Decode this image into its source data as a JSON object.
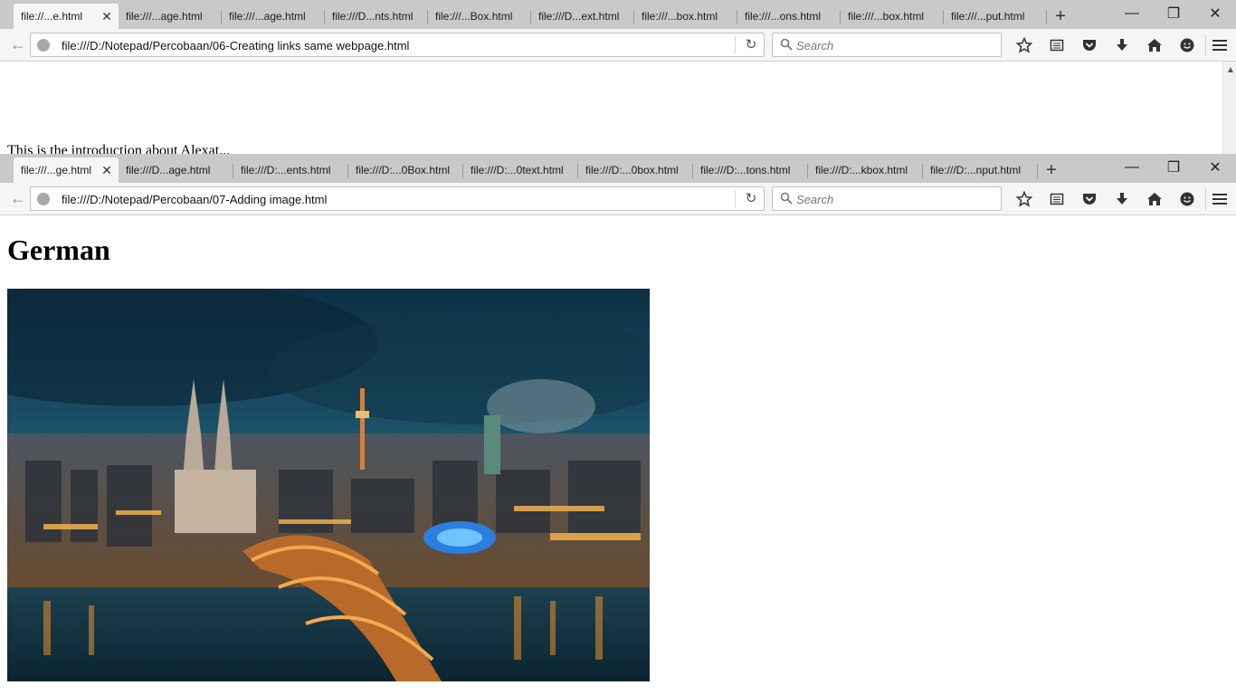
{
  "back_window": {
    "tabs": [
      {
        "label": "file://...e.html",
        "active": true
      },
      {
        "label": "file:///...age.html"
      },
      {
        "label": "file:///...age.html"
      },
      {
        "label": "file:///D...nts.html"
      },
      {
        "label": "file:///...Box.html"
      },
      {
        "label": "file:///D...ext.html"
      },
      {
        "label": "file:///...box.html"
      },
      {
        "label": "file:///...ons.html"
      },
      {
        "label": "file:///...box.html"
      },
      {
        "label": "file:///...put.html"
      }
    ],
    "url": "file:///D:/Notepad/Percobaan/06-Creating links same webpage.html",
    "search_placeholder": "Search",
    "page_text": "This is the introduction about Alexat..."
  },
  "front_window": {
    "tabs": [
      {
        "label": "file:///...ge.html",
        "active": true
      },
      {
        "label": "file:///D...age.html"
      },
      {
        "label": "file:///D:...ents.html"
      },
      {
        "label": "file:///D:...0Box.html"
      },
      {
        "label": "file:///D:...0text.html"
      },
      {
        "label": "file:///D:...0box.html"
      },
      {
        "label": "file:///D:...tons.html"
      },
      {
        "label": "file:///D:...kbox.html"
      },
      {
        "label": "file:///D:...nput.html"
      }
    ],
    "url": "file:///D:/Notepad/Percobaan/07-Adding image.html",
    "search_placeholder": "Search",
    "heading": "German"
  },
  "colors": {
    "tabbar": "#c9c9c9",
    "toolbar": "#f5f5f5"
  }
}
